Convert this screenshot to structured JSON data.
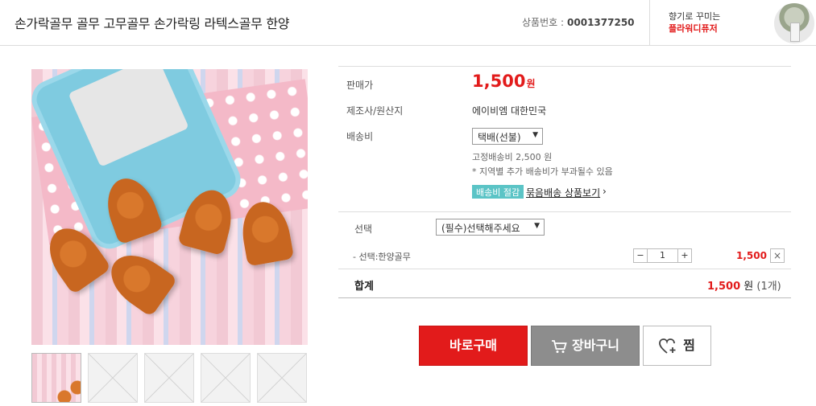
{
  "header": {
    "title": "손가락골무 골무 고무골무 손가락링 라텍스골무 한양",
    "code_label": "상품번호 :",
    "code_value": "0001377250",
    "promo_line1": "향기로 꾸미는",
    "promo_line2": "플라워디퓨저"
  },
  "product": {
    "price_label": "판매가",
    "price_value": "1,500",
    "price_unit": "원",
    "maker_label": "제조사/원산지",
    "maker_value": "에이비엠 대한민국",
    "shipping_label": "배송비",
    "shipping_select": "택배(선불)",
    "shipping_fee": "고정배송비 2,500 원",
    "shipping_note": "* 지역별 추가 배송비가 부과될수 있음",
    "bundle_badge": "배송비 절감",
    "bundle_link": "묶음배송 상품보기",
    "bundle_arrow": "›"
  },
  "option": {
    "label": "선택",
    "select_placeholder": "(필수)선택해주세요",
    "selected_item": "- 선택:한양골무",
    "qty": "1",
    "minus": "−",
    "plus": "+",
    "line_price": "1,500",
    "remove": "×"
  },
  "total": {
    "label": "합계",
    "amount": "1,500",
    "unit": "원",
    "count": "(1개)"
  },
  "buttons": {
    "buy": "바로구매",
    "cart": "장바구니",
    "wish": "찜"
  },
  "colors": {
    "accent_red": "#e21b1b",
    "badge_teal": "#5bc4c6",
    "cart_gray": "#8d8d8d"
  }
}
